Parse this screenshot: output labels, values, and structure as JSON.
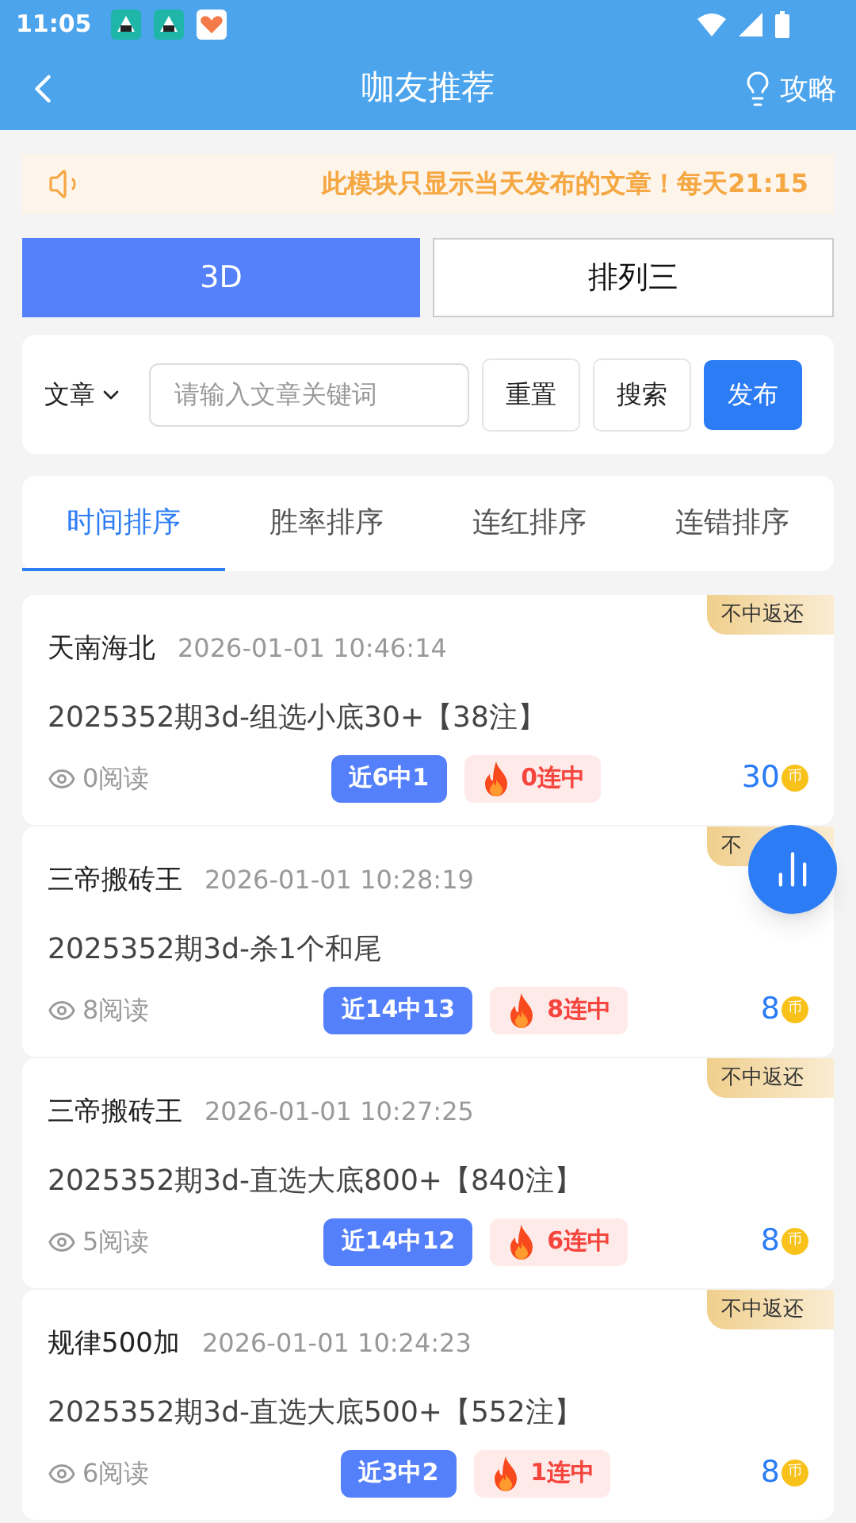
{
  "status_bar": {
    "time": "11:05"
  },
  "header": {
    "title": "咖友推荐",
    "action": "攻略"
  },
  "notice": {
    "text": "此模块只显示当天发布的文章！每天21:15"
  },
  "game_tabs": [
    {
      "label": "3D",
      "selected": true
    },
    {
      "label": "排列三",
      "selected": false
    }
  ],
  "search": {
    "category": "文章",
    "placeholder": "请输入文章关键词",
    "buttons": [
      {
        "label": "重置",
        "kind": "plain"
      },
      {
        "label": "搜索",
        "kind": "plain"
      },
      {
        "label": "发布",
        "kind": "primary"
      }
    ]
  },
  "sort_tabs": [
    {
      "label": "时间排序",
      "selected": true
    },
    {
      "label": "胜率排序",
      "selected": false
    },
    {
      "label": "连红排序",
      "selected": false
    },
    {
      "label": "连错排序",
      "selected": false
    }
  ],
  "articles": [
    {
      "author": "天南海北",
      "time": "2026-01-01 10:46:14",
      "title": "2025352期3d-组选小底30+【38注】",
      "reads": "0阅读",
      "record": "近6中1",
      "streak": "0连中",
      "price": "30",
      "coin": "币",
      "badge": "不中返还"
    },
    {
      "author": "三帝搬砖王",
      "time": "2026-01-01 10:28:19",
      "title": "2025352期3d-杀1个和尾",
      "reads": "8阅读",
      "record": "近14中13",
      "streak": "8连中",
      "price": "8",
      "coin": "币",
      "badge": "不"
    },
    {
      "author": "三帝搬砖王",
      "time": "2026-01-01 10:27:25",
      "title": "2025352期3d-直选大底800+【840注】",
      "reads": "5阅读",
      "record": "近14中12",
      "streak": "6连中",
      "price": "8",
      "coin": "币",
      "badge": "不中返还"
    },
    {
      "author": "规律500加",
      "time": "2026-01-01 10:24:23",
      "title": "2025352期3d-直选大底500+【552注】",
      "reads": "6阅读",
      "record": "近3中2",
      "streak": "1连中",
      "price": "8",
      "coin": "币",
      "badge": "不中返还"
    }
  ]
}
